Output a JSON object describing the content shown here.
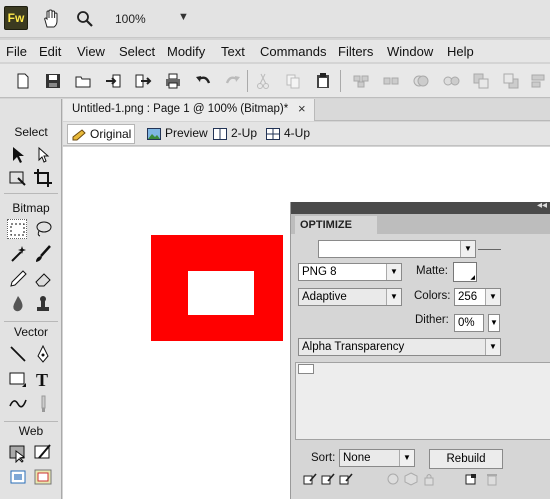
{
  "app": {
    "logo_text": "Fw",
    "zoom": "100%"
  },
  "menu": [
    "File",
    "Edit",
    "View",
    "Select",
    "Modify",
    "Text",
    "Commands",
    "Filters",
    "Window",
    "Help"
  ],
  "tools_panel": {
    "sections": [
      "Select",
      "Bitmap",
      "Vector",
      "Web"
    ]
  },
  "document": {
    "tab_title": "Untitled-1.png : Page 1 @ 100% (Bitmap)*",
    "close_glyph": "×",
    "views": [
      "Original",
      "Preview",
      "2-Up",
      "4-Up"
    ],
    "active_view": "Original"
  },
  "canvas": {
    "shape_fill": "#ff0000",
    "inner_fill": "#ffffff"
  },
  "optimize_panel": {
    "tab": "OPTIMIZE",
    "preset_value": "",
    "format": "PNG 8",
    "matte_label": "Matte:",
    "palette": "Adaptive",
    "colors_label": "Colors:",
    "colors_value": "256",
    "dither_label": "Dither:",
    "dither_value": "0%",
    "transparency": "Alpha Transparency",
    "sort_label": "Sort:",
    "sort_value": "None",
    "rebuild_label": "Rebuild"
  }
}
